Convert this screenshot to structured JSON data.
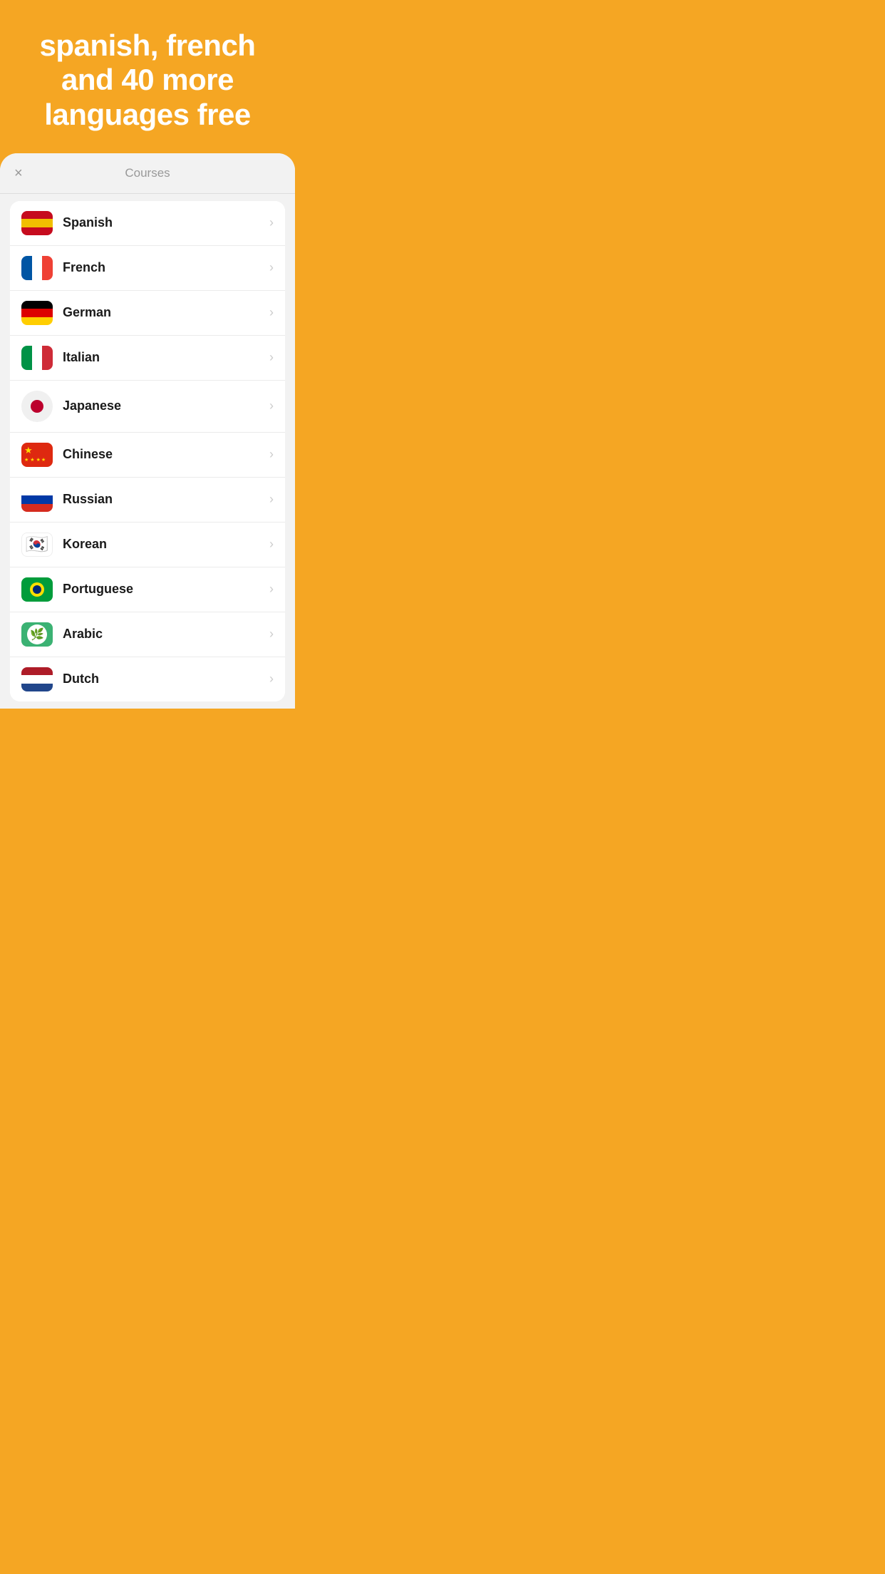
{
  "header": {
    "title": "spanish, french and 40 more languages free",
    "background": "#F5A623"
  },
  "card": {
    "close_label": "×",
    "title": "Courses"
  },
  "languages": [
    {
      "id": "spanish",
      "name": "Spanish",
      "flag": "spanish"
    },
    {
      "id": "french",
      "name": "French",
      "flag": "french"
    },
    {
      "id": "german",
      "name": "German",
      "flag": "german"
    },
    {
      "id": "italian",
      "name": "Italian",
      "flag": "italian"
    },
    {
      "id": "japanese",
      "name": "Japanese",
      "flag": "japanese"
    },
    {
      "id": "chinese",
      "name": "Chinese",
      "flag": "chinese"
    },
    {
      "id": "russian",
      "name": "Russian",
      "flag": "russian"
    },
    {
      "id": "korean",
      "name": "Korean",
      "flag": "korean"
    },
    {
      "id": "portuguese",
      "name": "Portuguese",
      "flag": "portuguese"
    },
    {
      "id": "arabic",
      "name": "Arabic",
      "flag": "arabic"
    },
    {
      "id": "dutch",
      "name": "Dutch",
      "flag": "dutch"
    }
  ],
  "chevron": "›"
}
